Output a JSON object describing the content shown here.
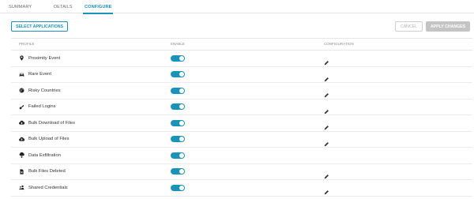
{
  "tabs": [
    {
      "label": "SUMMARY",
      "active": false
    },
    {
      "label": "DETAILS",
      "active": false
    },
    {
      "label": "CONFIGURE",
      "active": true
    }
  ],
  "buttons": {
    "select_applications": "SELECT APPLICATIONS",
    "cancel": "CANCEL",
    "apply_changes": "APPLY CHANGES"
  },
  "table": {
    "columns": {
      "profile": "PROFILE",
      "enable": "ENABLE",
      "configuration": "CONFIGURATION"
    },
    "rows": [
      {
        "label": "Proximity Event",
        "icon": "location-pin-icon",
        "enabled": true,
        "editable": true
      },
      {
        "label": "Rare Event",
        "icon": "car-icon",
        "enabled": true,
        "editable": true
      },
      {
        "label": "Risky Countries",
        "icon": "globe-icon",
        "enabled": true,
        "editable": true
      },
      {
        "label": "Failed Logins",
        "icon": "key-icon",
        "enabled": true,
        "editable": true
      },
      {
        "label": "Bulk Download of Files",
        "icon": "cloud-download-icon",
        "enabled": true,
        "editable": true
      },
      {
        "label": "Bulk Upload of Files",
        "icon": "cloud-upload-icon",
        "enabled": true,
        "editable": true
      },
      {
        "label": "Data Exfiltration",
        "icon": "exfiltration-icon",
        "enabled": true,
        "editable": false
      },
      {
        "label": "Bulk Files Deleted",
        "icon": "file-delete-icon",
        "enabled": true,
        "editable": true
      },
      {
        "label": "Shared Credentials",
        "icon": "shared-users-icon",
        "enabled": true,
        "editable": true
      }
    ]
  },
  "colors": {
    "accent": "#1b93b8",
    "disabled_button": "#c4c4c4"
  }
}
